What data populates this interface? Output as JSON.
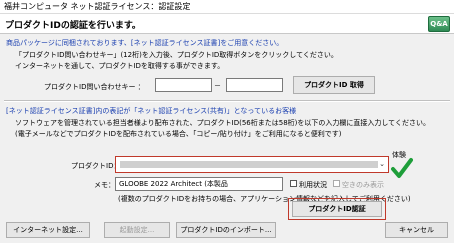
{
  "window": {
    "title": "福井コンピュータ ネット認証ライセンス：認証設定"
  },
  "header": {
    "title": "プロダクトIDの認証を行います。",
    "help_label": "Q&A"
  },
  "package": {
    "heading": "商品パッケージに同梱されております、[ネット認証ライセンス証書]をご用意ください。",
    "line1": "「プロダクトID問い合わせキー」(12桁)を入力後、プロダクトID取得ボタンをクリックしてください。",
    "line2": "インターネットを通して、プロダクトIDを取得する事ができます。",
    "inquiry_label": "プロダクトID問い合わせキー ：",
    "inquiry_part1": "",
    "dash": "－",
    "inquiry_part2": "",
    "get_button": "プロダクトID 取得"
  },
  "shared": {
    "heading": "[ネット認証ライセンス証書]内の表記が「ネット認証ライセンス(共有)」となっているお客様",
    "line1": "ソフトウェアを管理されている担当者様より配布された、プロダクトID(56桁または58桁)を以下の入力欄に直接入力してください。",
    "line2": "(電子メールなどでプロダクトIDを配布されている場合、「コピー/貼り付け」をご利用になると便利です)"
  },
  "form": {
    "product_id_label": "プロダクトID：",
    "product_id_value": "",
    "trial_label": "体験",
    "memo_label": "メモ：",
    "memo_value": "GLOOBE 2022 Architect (本製品",
    "usage_label": "利用状況",
    "vacant_label": "空きのみ表示",
    "note": "(複数のプロダクトIDをお持ちの場合、アプリケーション情報などを記入してご利用ください)",
    "auth_button": "プロダクトID認証"
  },
  "footer": {
    "internet_settings": "インターネット設定...",
    "activation_settings": "起動設定...",
    "import_button": "プロダクトIDのインポート...",
    "cancel_button": "キャンセル"
  },
  "colors": {
    "accent_blue": "#1a3fb0",
    "focus_red": "#c0392b",
    "check_green": "#1e9e3a"
  }
}
